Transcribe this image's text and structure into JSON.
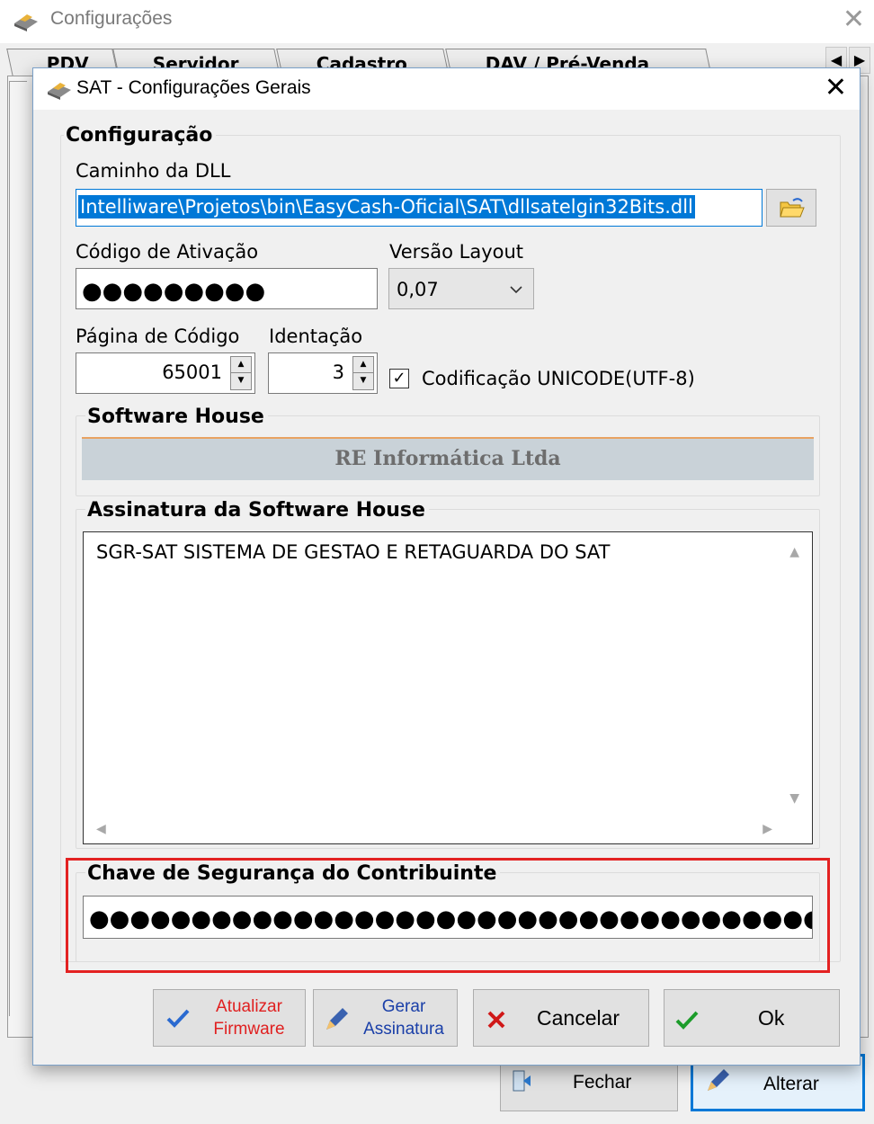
{
  "parent_window": {
    "title": "Configurações",
    "close_label": "✕",
    "tabs": [
      "PDV",
      "Servidor",
      "Cadastro",
      "DAV / Pré-Venda"
    ],
    "buttons": {
      "close": "Fechar",
      "edit": "Alterar"
    }
  },
  "dialog": {
    "title": "SAT - Configurações Gerais",
    "close_label": "✕",
    "config_group": {
      "legend": "Configuração",
      "dll_path_label": "Caminho da DLL",
      "dll_path_value": "Intelliware\\Projetos\\bin\\EasyCash-Oficial\\SAT\\dllsatelgin32Bits.dll",
      "activation_code_label": "Código de Ativação",
      "activation_code_masked": "●●●●●●●●●",
      "layout_version_label": "Versão Layout",
      "layout_version_value": "0,07",
      "code_page_label": "Página de Código",
      "code_page_value": "65001",
      "indentation_label": "Identação",
      "indentation_value": "3",
      "unicode_checkbox_label": "Codificação UNICODE(UTF-8)",
      "unicode_checked": true
    },
    "software_house": {
      "legend": "Software House",
      "name": "RE Informática Ltda"
    },
    "signature": {
      "legend": "Assinatura da Software House",
      "text": "SGR-SAT SISTEMA DE GESTAO E RETAGUARDA DO SAT"
    },
    "security_key": {
      "legend": "Chave de Segurança do Contribuinte",
      "masked": "●●●●●●●●●●●●●●●●●●●●●●●●●●●●●●●●●●●●"
    },
    "buttons": {
      "update_firmware": [
        "Atualizar",
        "Firmware"
      ],
      "generate_signature": [
        "Gerar",
        "Assinatura"
      ],
      "cancel": "Cancelar",
      "ok": "Ok"
    }
  },
  "colors": {
    "accent": "#0078d7",
    "highlight_border": "#e32222",
    "firmware_text": "#e02020",
    "signature_text": "#1a3fa8"
  }
}
